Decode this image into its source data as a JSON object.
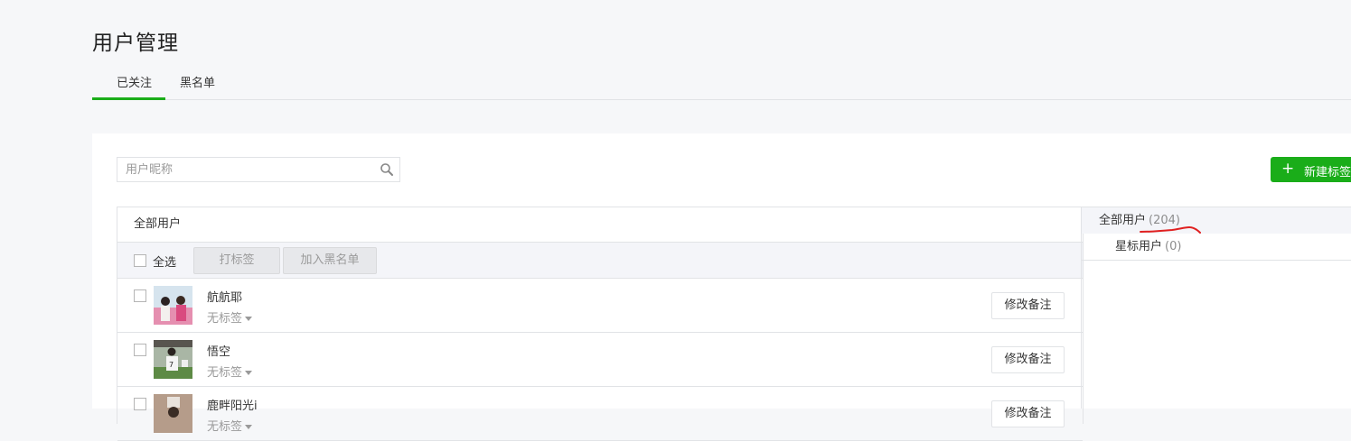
{
  "page": {
    "title": "用户管理"
  },
  "tabs": [
    {
      "label": "已关注",
      "active": true
    },
    {
      "label": "黑名单",
      "active": false
    }
  ],
  "search": {
    "placeholder": "用户昵称",
    "value": "",
    "icon": "search-icon"
  },
  "actions": {
    "new_tag_label": "新建标签"
  },
  "list": {
    "header": "全部用户",
    "toolbar": {
      "select_all_label": "全选",
      "tag_button_label": "打标签",
      "blacklist_button_label": "加入黑名单"
    },
    "users": [
      {
        "nickname": "航航耶",
        "tag": "无标签",
        "remark_button": "修改备注"
      },
      {
        "nickname": "悟空",
        "tag": "无标签",
        "remark_button": "修改备注"
      },
      {
        "nickname": "鹿畔阳光i",
        "tag": "无标签",
        "remark_button": "修改备注"
      }
    ]
  },
  "groups": [
    {
      "label": "全部用户",
      "count": "(204)",
      "active": true
    },
    {
      "label": "星标用户",
      "count": "(0)",
      "active": false
    }
  ],
  "colors": {
    "accent": "#1aad19",
    "annotation": "#e02020"
  }
}
